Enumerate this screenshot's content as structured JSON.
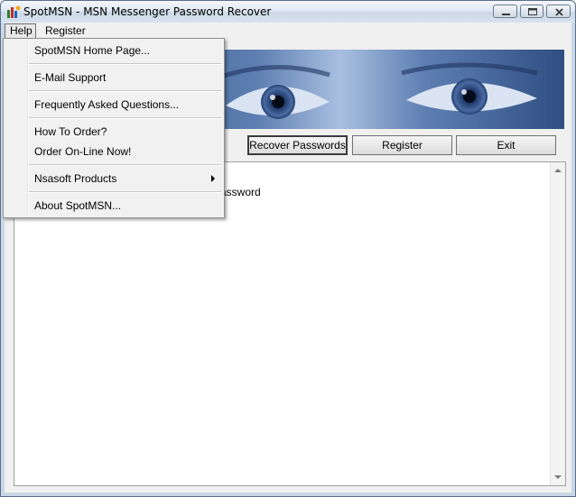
{
  "window": {
    "title": "SpotMSN - MSN Messenger Password Recover"
  },
  "menubar": {
    "help": "Help",
    "register": "Register"
  },
  "help_menu": {
    "items": [
      "SpotMSN Home Page...",
      "E-Mail Support",
      "Frequently Asked Questions...",
      "How To Order?",
      "Order On-Line Now!",
      "Nsasoft Products",
      "About SpotMSN..."
    ]
  },
  "buttons": {
    "recover": "Recover Passwords",
    "register": "Register",
    "exit": "Exit"
  },
  "output": {
    "visible_text": "r password"
  },
  "colors": {
    "banner_blue": "#3d5a8e",
    "titlebar": "#dfe8f2"
  }
}
